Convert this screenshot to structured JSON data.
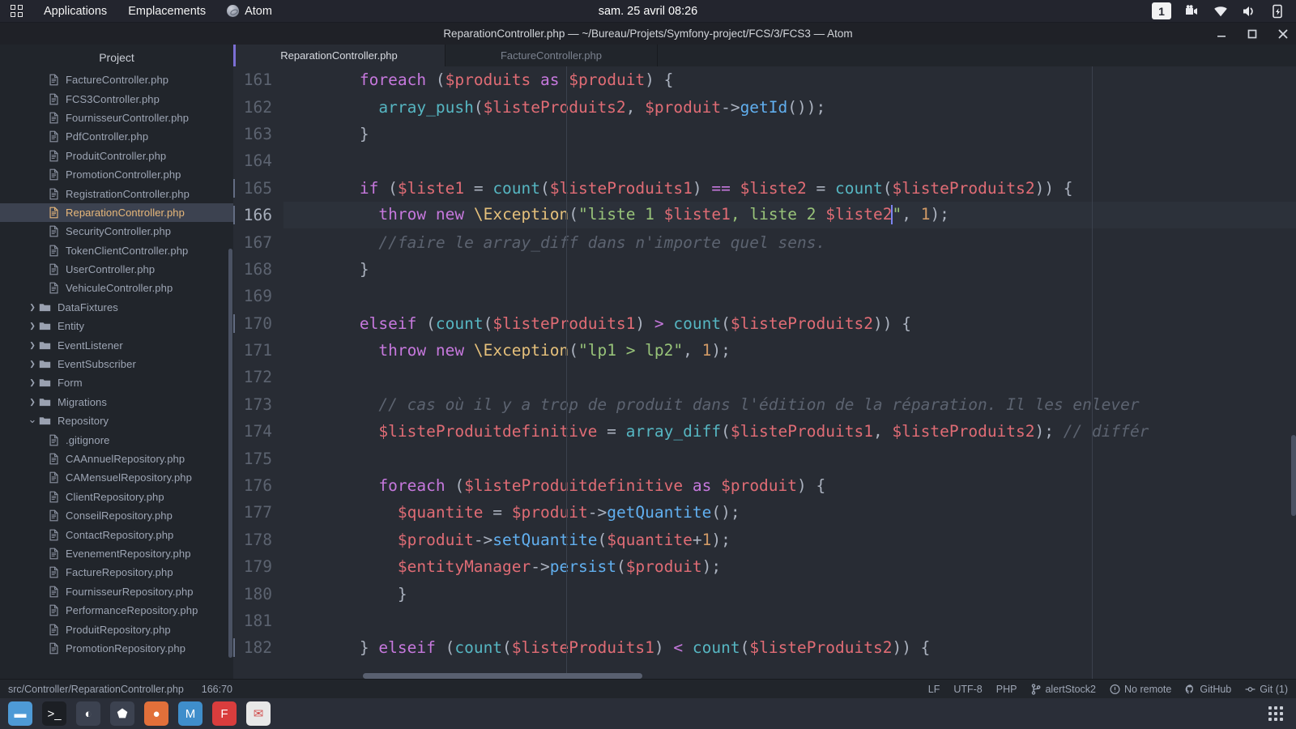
{
  "top_panel": {
    "activities_icon": "grid-icon",
    "applications_label": "Applications",
    "places_label": "Emplacements",
    "app_icon": "atom-icon",
    "app_label": "Atom",
    "clock": "sam. 25 avril  08:26",
    "workspace": "1",
    "tray_icons": [
      "screen-recorder-icon",
      "wifi-icon",
      "volume-icon",
      "battery-charging-icon"
    ]
  },
  "window": {
    "title": "ReparationController.php — ~/Bureau/Projets/Symfony-project/FCS/3/FCS3 — Atom",
    "controls": [
      "minimize-button",
      "maximize-button",
      "close-button"
    ]
  },
  "tree": {
    "header": "Project",
    "items": [
      {
        "label": "FactureController.php",
        "type": "file",
        "depth": 2
      },
      {
        "label": "FCS3Controller.php",
        "type": "file",
        "depth": 2
      },
      {
        "label": "FournisseurController.php",
        "type": "file",
        "depth": 2
      },
      {
        "label": "PdfController.php",
        "type": "file",
        "depth": 2
      },
      {
        "label": "ProduitController.php",
        "type": "file",
        "depth": 2
      },
      {
        "label": "PromotionController.php",
        "type": "file",
        "depth": 2
      },
      {
        "label": "RegistrationController.php",
        "type": "file",
        "depth": 2
      },
      {
        "label": "ReparationController.php",
        "type": "file",
        "depth": 2,
        "selected": true
      },
      {
        "label": "SecurityController.php",
        "type": "file",
        "depth": 2
      },
      {
        "label": "TokenClientController.php",
        "type": "file",
        "depth": 2
      },
      {
        "label": "UserController.php",
        "type": "file",
        "depth": 2
      },
      {
        "label": "VehiculeController.php",
        "type": "file",
        "depth": 2
      },
      {
        "label": "DataFixtures",
        "type": "folder",
        "depth": 1,
        "expanded": false
      },
      {
        "label": "Entity",
        "type": "folder",
        "depth": 1,
        "expanded": false
      },
      {
        "label": "EventListener",
        "type": "folder",
        "depth": 1,
        "expanded": false
      },
      {
        "label": "EventSubscriber",
        "type": "folder",
        "depth": 1,
        "expanded": false
      },
      {
        "label": "Form",
        "type": "folder",
        "depth": 1,
        "expanded": false
      },
      {
        "label": "Migrations",
        "type": "folder",
        "depth": 1,
        "expanded": false
      },
      {
        "label": "Repository",
        "type": "folder",
        "depth": 1,
        "expanded": true
      },
      {
        "label": ".gitignore",
        "type": "file",
        "depth": 2
      },
      {
        "label": "CAAnnuelRepository.php",
        "type": "file",
        "depth": 2
      },
      {
        "label": "CAMensuelRepository.php",
        "type": "file",
        "depth": 2
      },
      {
        "label": "ClientRepository.php",
        "type": "file",
        "depth": 2
      },
      {
        "label": "ConseilRepository.php",
        "type": "file",
        "depth": 2
      },
      {
        "label": "ContactRepository.php",
        "type": "file",
        "depth": 2
      },
      {
        "label": "EvenementRepository.php",
        "type": "file",
        "depth": 2
      },
      {
        "label": "FactureRepository.php",
        "type": "file",
        "depth": 2
      },
      {
        "label": "FournisseurRepository.php",
        "type": "file",
        "depth": 2
      },
      {
        "label": "PerformanceRepository.php",
        "type": "file",
        "depth": 2
      },
      {
        "label": "ProduitRepository.php",
        "type": "file",
        "depth": 2
      },
      {
        "label": "PromotionRepository.php",
        "type": "file",
        "depth": 2
      }
    ]
  },
  "tabs": [
    {
      "label": "ReparationController.php",
      "active": true
    },
    {
      "label": "FactureController.php",
      "active": false
    }
  ],
  "editor": {
    "language": "PHP",
    "lines": [
      {
        "n": "161",
        "fold": false,
        "tokens": [
          {
            "t": "        ",
            "c": "t-pun"
          },
          {
            "t": "foreach",
            "c": "t-kw"
          },
          {
            "t": " (",
            "c": "t-pun"
          },
          {
            "t": "$produits",
            "c": "t-var"
          },
          {
            "t": " ",
            "c": "t-pun"
          },
          {
            "t": "as",
            "c": "t-kw"
          },
          {
            "t": " ",
            "c": "t-pun"
          },
          {
            "t": "$produit",
            "c": "t-var"
          },
          {
            "t": ") {",
            "c": "t-pun"
          }
        ]
      },
      {
        "n": "162",
        "fold": false,
        "tokens": [
          {
            "t": "          ",
            "c": "t-pun"
          },
          {
            "t": "array_push",
            "c": "t-fn"
          },
          {
            "t": "(",
            "c": "t-pun"
          },
          {
            "t": "$listeProduits2",
            "c": "t-var"
          },
          {
            "t": ", ",
            "c": "t-pun"
          },
          {
            "t": "$produit",
            "c": "t-var"
          },
          {
            "t": "->",
            "c": "t-pun"
          },
          {
            "t": "getId",
            "c": "t-meth"
          },
          {
            "t": "());",
            "c": "t-pun"
          }
        ]
      },
      {
        "n": "163",
        "fold": false,
        "tokens": [
          {
            "t": "        }",
            "c": "t-pun"
          }
        ]
      },
      {
        "n": "164",
        "fold": false,
        "tokens": []
      },
      {
        "n": "165",
        "fold": true,
        "tokens": [
          {
            "t": "        ",
            "c": "t-pun"
          },
          {
            "t": "if",
            "c": "t-kw"
          },
          {
            "t": " (",
            "c": "t-pun"
          },
          {
            "t": "$liste1",
            "c": "t-var"
          },
          {
            "t": " = ",
            "c": "t-pun"
          },
          {
            "t": "count",
            "c": "t-fn"
          },
          {
            "t": "(",
            "c": "t-pun"
          },
          {
            "t": "$listeProduits1",
            "c": "t-var"
          },
          {
            "t": ") ",
            "c": "t-pun"
          },
          {
            "t": "==",
            "c": "t-kw"
          },
          {
            "t": " ",
            "c": "t-pun"
          },
          {
            "t": "$liste2",
            "c": "t-var"
          },
          {
            "t": " = ",
            "c": "t-pun"
          },
          {
            "t": "count",
            "c": "t-fn"
          },
          {
            "t": "(",
            "c": "t-pun"
          },
          {
            "t": "$listeProduits2",
            "c": "t-var"
          },
          {
            "t": ")) {",
            "c": "t-pun"
          }
        ]
      },
      {
        "n": "166",
        "fold": true,
        "active": true,
        "tokens": [
          {
            "t": "          ",
            "c": "t-pun"
          },
          {
            "t": "throw",
            "c": "t-kw"
          },
          {
            "t": " ",
            "c": "t-pun"
          },
          {
            "t": "new",
            "c": "t-kw"
          },
          {
            "t": " ",
            "c": "t-pun"
          },
          {
            "t": "\\Exception",
            "c": "t-cls"
          },
          {
            "t": "(",
            "c": "t-pun"
          },
          {
            "t": "\"liste 1 ",
            "c": "t-str"
          },
          {
            "t": "$liste1",
            "c": "t-var"
          },
          {
            "t": ", liste 2 ",
            "c": "t-str"
          },
          {
            "t": "$liste2",
            "c": "t-var"
          },
          {
            "t": "__CURSOR__",
            "c": "cursor"
          },
          {
            "t": "\"",
            "c": "t-str"
          },
          {
            "t": ", ",
            "c": "t-pun"
          },
          {
            "t": "1",
            "c": "t-num"
          },
          {
            "t": ");",
            "c": "t-pun"
          }
        ]
      },
      {
        "n": "167",
        "fold": false,
        "tokens": [
          {
            "t": "          ",
            "c": "t-pun"
          },
          {
            "t": "//faire le array_diff dans n'importe quel sens.",
            "c": "t-com"
          }
        ]
      },
      {
        "n": "168",
        "fold": false,
        "tokens": [
          {
            "t": "        }",
            "c": "t-pun"
          }
        ]
      },
      {
        "n": "169",
        "fold": false,
        "tokens": []
      },
      {
        "n": "170",
        "fold": true,
        "tokens": [
          {
            "t": "        ",
            "c": "t-pun"
          },
          {
            "t": "elseif",
            "c": "t-kw"
          },
          {
            "t": " (",
            "c": "t-pun"
          },
          {
            "t": "count",
            "c": "t-fn"
          },
          {
            "t": "(",
            "c": "t-pun"
          },
          {
            "t": "$listeProduits1",
            "c": "t-var"
          },
          {
            "t": ") ",
            "c": "t-pun"
          },
          {
            "t": ">",
            "c": "t-kw"
          },
          {
            "t": " ",
            "c": "t-pun"
          },
          {
            "t": "count",
            "c": "t-fn"
          },
          {
            "t": "(",
            "c": "t-pun"
          },
          {
            "t": "$listeProduits2",
            "c": "t-var"
          },
          {
            "t": ")) {",
            "c": "t-pun"
          }
        ]
      },
      {
        "n": "171",
        "fold": false,
        "tokens": [
          {
            "t": "          ",
            "c": "t-pun"
          },
          {
            "t": "throw",
            "c": "t-kw"
          },
          {
            "t": " ",
            "c": "t-pun"
          },
          {
            "t": "new",
            "c": "t-kw"
          },
          {
            "t": " ",
            "c": "t-pun"
          },
          {
            "t": "\\Exception",
            "c": "t-cls"
          },
          {
            "t": "(",
            "c": "t-pun"
          },
          {
            "t": "\"lp1 > lp2\"",
            "c": "t-str"
          },
          {
            "t": ", ",
            "c": "t-pun"
          },
          {
            "t": "1",
            "c": "t-num"
          },
          {
            "t": ");",
            "c": "t-pun"
          }
        ]
      },
      {
        "n": "172",
        "fold": false,
        "tokens": []
      },
      {
        "n": "173",
        "fold": false,
        "tokens": [
          {
            "t": "          ",
            "c": "t-pun"
          },
          {
            "t": "// cas où il y a trop de produit dans l'édition de la réparation. Il les enlever",
            "c": "t-com"
          }
        ]
      },
      {
        "n": "174",
        "fold": false,
        "tokens": [
          {
            "t": "          ",
            "c": "t-pun"
          },
          {
            "t": "$listeProduitdefinitive",
            "c": "t-var"
          },
          {
            "t": " = ",
            "c": "t-pun"
          },
          {
            "t": "array_diff",
            "c": "t-fn"
          },
          {
            "t": "(",
            "c": "t-pun"
          },
          {
            "t": "$listeProduits1",
            "c": "t-var"
          },
          {
            "t": ", ",
            "c": "t-pun"
          },
          {
            "t": "$listeProduits2",
            "c": "t-var"
          },
          {
            "t": "); ",
            "c": "t-pun"
          },
          {
            "t": "// différ",
            "c": "t-com"
          }
        ]
      },
      {
        "n": "175",
        "fold": false,
        "tokens": []
      },
      {
        "n": "176",
        "fold": false,
        "tokens": [
          {
            "t": "          ",
            "c": "t-pun"
          },
          {
            "t": "foreach",
            "c": "t-kw"
          },
          {
            "t": " (",
            "c": "t-pun"
          },
          {
            "t": "$listeProduitdefinitive",
            "c": "t-var"
          },
          {
            "t": " ",
            "c": "t-pun"
          },
          {
            "t": "as",
            "c": "t-kw"
          },
          {
            "t": " ",
            "c": "t-pun"
          },
          {
            "t": "$produit",
            "c": "t-var"
          },
          {
            "t": ") {",
            "c": "t-pun"
          }
        ]
      },
      {
        "n": "177",
        "fold": false,
        "tokens": [
          {
            "t": "            ",
            "c": "t-pun"
          },
          {
            "t": "$quantite",
            "c": "t-var"
          },
          {
            "t": " = ",
            "c": "t-pun"
          },
          {
            "t": "$produit",
            "c": "t-var"
          },
          {
            "t": "->",
            "c": "t-pun"
          },
          {
            "t": "getQuantite",
            "c": "t-meth"
          },
          {
            "t": "();",
            "c": "t-pun"
          }
        ]
      },
      {
        "n": "178",
        "fold": false,
        "tokens": [
          {
            "t": "            ",
            "c": "t-pun"
          },
          {
            "t": "$produit",
            "c": "t-var"
          },
          {
            "t": "->",
            "c": "t-pun"
          },
          {
            "t": "setQuantite",
            "c": "t-meth"
          },
          {
            "t": "(",
            "c": "t-pun"
          },
          {
            "t": "$quantite",
            "c": "t-var"
          },
          {
            "t": "+",
            "c": "t-pun"
          },
          {
            "t": "1",
            "c": "t-num"
          },
          {
            "t": ");",
            "c": "t-pun"
          }
        ]
      },
      {
        "n": "179",
        "fold": false,
        "tokens": [
          {
            "t": "            ",
            "c": "t-pun"
          },
          {
            "t": "$entityManager",
            "c": "t-var"
          },
          {
            "t": "->",
            "c": "t-pun"
          },
          {
            "t": "persist",
            "c": "t-meth"
          },
          {
            "t": "(",
            "c": "t-pun"
          },
          {
            "t": "$produit",
            "c": "t-var"
          },
          {
            "t": ");",
            "c": "t-pun"
          }
        ]
      },
      {
        "n": "180",
        "fold": false,
        "tokens": [
          {
            "t": "            }",
            "c": "t-pun"
          }
        ]
      },
      {
        "n": "181",
        "fold": false,
        "tokens": []
      },
      {
        "n": "182",
        "fold": true,
        "tokens": [
          {
            "t": "        } ",
            "c": "t-pun"
          },
          {
            "t": "elseif",
            "c": "t-kw"
          },
          {
            "t": " (",
            "c": "t-pun"
          },
          {
            "t": "count",
            "c": "t-fn"
          },
          {
            "t": "(",
            "c": "t-pun"
          },
          {
            "t": "$listeProduits1",
            "c": "t-var"
          },
          {
            "t": ") ",
            "c": "t-pun"
          },
          {
            "t": "<",
            "c": "t-kw"
          },
          {
            "t": " ",
            "c": "t-pun"
          },
          {
            "t": "count",
            "c": "t-fn"
          },
          {
            "t": "(",
            "c": "t-pun"
          },
          {
            "t": "$listeProduits2",
            "c": "t-var"
          },
          {
            "t": ")) {",
            "c": "t-pun"
          }
        ]
      }
    ]
  },
  "status_bar": {
    "file_path": "src/Controller/ReparationController.php",
    "cursor_position": "166:70",
    "line_ending": "LF",
    "encoding": "UTF-8",
    "grammar": "PHP",
    "git_branch": "alertStock2",
    "remote": "No remote",
    "github": "GitHub",
    "git_changes": "Git (1)"
  },
  "dock": {
    "items": [
      {
        "name": "files-icon",
        "glyph": "▬",
        "color": "#4e9ad6"
      },
      {
        "name": "terminal-icon",
        "glyph": ">_",
        "color": "#1c1f24"
      },
      {
        "name": "gimp-icon",
        "glyph": "◐",
        "color": "#3c4250"
      },
      {
        "name": "inkscape-icon",
        "glyph": "⬟",
        "color": "#3c4250"
      },
      {
        "name": "firefox-icon",
        "glyph": "●",
        "color": "#e2703a"
      },
      {
        "name": "music-icon",
        "glyph": "M",
        "color": "#3f8ecb"
      },
      {
        "name": "filezilla-icon",
        "glyph": "F",
        "color": "#d93d3d"
      },
      {
        "name": "mail-icon",
        "glyph": "✉",
        "color": "#e8e8e8"
      }
    ],
    "show_apps": "show-applications-icon"
  },
  "theme": {
    "accent": "#7c6fd4",
    "bg_editor": "#282c34",
    "bg_chrome": "#21252b",
    "selected_file": "#e8b87a"
  }
}
